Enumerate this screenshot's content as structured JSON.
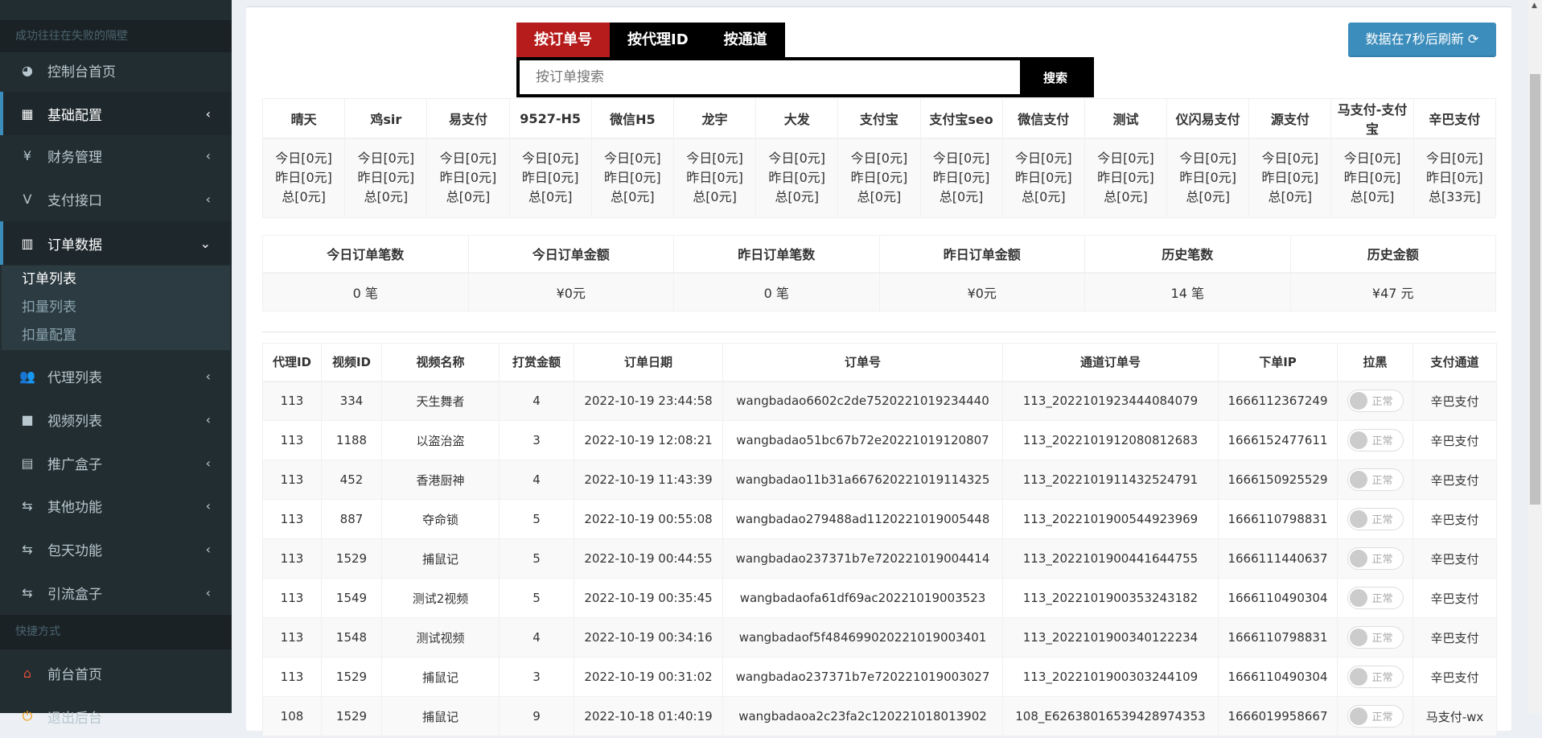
{
  "sidebar": {
    "motto": "成功往往在失败的隔壁",
    "items": [
      {
        "label": "控制台首页",
        "icon": "dashboard-icon",
        "glyph": "◕"
      },
      {
        "label": "基础配置",
        "icon": "grid-icon",
        "glyph": "▦",
        "chev": "‹"
      },
      {
        "label": "财务管理",
        "icon": "yen-icon",
        "glyph": "¥",
        "chev": "‹"
      },
      {
        "label": "支付接口",
        "icon": "vimeo-icon",
        "glyph": "V",
        "chev": "‹"
      },
      {
        "label": "订单数据",
        "icon": "bar-chart-icon",
        "glyph": "▥",
        "chev": "⌄"
      },
      {
        "label": "代理列表",
        "icon": "users-icon",
        "glyph": "👥",
        "chev": "‹"
      },
      {
        "label": "视频列表",
        "icon": "video-camera-icon",
        "glyph": "■",
        "chev": "‹"
      },
      {
        "label": "推广盒子",
        "icon": "table-icon",
        "glyph": "▤",
        "chev": "‹"
      },
      {
        "label": "其他功能",
        "icon": "retweet-icon",
        "glyph": "⇆",
        "chev": "‹"
      },
      {
        "label": "包天功能",
        "icon": "retweet-icon",
        "glyph": "⇆",
        "chev": "‹"
      },
      {
        "label": "引流盒子",
        "icon": "retweet-icon",
        "glyph": "⇆",
        "chev": "‹"
      }
    ],
    "submenu": [
      "订单列表",
      "扣量列表",
      "扣量配置"
    ],
    "shortcut_header": "快捷方式",
    "shortcuts": [
      {
        "label": "前台首页",
        "icon": "home-icon",
        "glyph": "⌂",
        "color": "#dd4b39"
      },
      {
        "label": "退出后台",
        "icon": "power-icon",
        "glyph": "⏻",
        "color": "#f39c12"
      }
    ]
  },
  "search": {
    "tabs": [
      "按订单号",
      "按代理ID",
      "按通道"
    ],
    "placeholder": "按订单搜索",
    "button": "搜索",
    "refresh": "数据在7秒后刷新 ⟳"
  },
  "channels": [
    {
      "name": "晴天",
      "today": "今日[0元]",
      "yesterday": "昨日[0元]",
      "total": "总[0元]"
    },
    {
      "name": "鸡sir",
      "today": "今日[0元]",
      "yesterday": "昨日[0元]",
      "total": "总[0元]"
    },
    {
      "name": "易支付",
      "today": "今日[0元]",
      "yesterday": "昨日[0元]",
      "total": "总[0元]"
    },
    {
      "name": "9527-H5",
      "today": "今日[0元]",
      "yesterday": "昨日[0元]",
      "total": "总[0元]"
    },
    {
      "name": "微信H5",
      "today": "今日[0元]",
      "yesterday": "昨日[0元]",
      "total": "总[0元]"
    },
    {
      "name": "龙宇",
      "today": "今日[0元]",
      "yesterday": "昨日[0元]",
      "total": "总[0元]"
    },
    {
      "name": "大发",
      "today": "今日[0元]",
      "yesterday": "昨日[0元]",
      "total": "总[0元]"
    },
    {
      "name": "支付宝",
      "today": "今日[0元]",
      "yesterday": "昨日[0元]",
      "total": "总[0元]"
    },
    {
      "name": "支付宝seo",
      "today": "今日[0元]",
      "yesterday": "昨日[0元]",
      "total": "总[0元]"
    },
    {
      "name": "微信支付",
      "today": "今日[0元]",
      "yesterday": "昨日[0元]",
      "total": "总[0元]"
    },
    {
      "name": "测试",
      "today": "今日[0元]",
      "yesterday": "昨日[0元]",
      "total": "总[0元]"
    },
    {
      "name": "仪闪易支付",
      "today": "今日[0元]",
      "yesterday": "昨日[0元]",
      "total": "总[0元]"
    },
    {
      "name": "源支付",
      "today": "今日[0元]",
      "yesterday": "昨日[0元]",
      "total": "总[0元]"
    },
    {
      "name": "马支付-支付宝",
      "today": "今日[0元]",
      "yesterday": "昨日[0元]",
      "total": "总[0元]"
    },
    {
      "name": "辛巴支付",
      "today": "今日[0元]",
      "yesterday": "昨日[0元]",
      "total": "总[33元]"
    }
  ],
  "summary": {
    "headers": [
      "今日订单笔数",
      "今日订单金额",
      "昨日订单笔数",
      "昨日订单金额",
      "历史笔数",
      "历史金额"
    ],
    "values": [
      "0 笔",
      "¥0元",
      "0 笔",
      "¥0元",
      "14 笔",
      "¥47 元"
    ]
  },
  "orders": {
    "headers": [
      "代理ID",
      "视频ID",
      "视频名称",
      "打赏金额",
      "订单日期",
      "订单号",
      "通道订单号",
      "下单IP",
      "拉黑",
      "支付通道"
    ],
    "rows": [
      [
        "113",
        "334",
        "天生舞者",
        "4",
        "2022-10-19 23:44:58",
        "wangbadao6602c2de7520221019234440",
        "113_2022101923444084079",
        "1666112367249",
        "正常",
        "辛巴支付"
      ],
      [
        "113",
        "1188",
        "以盗治盗",
        "3",
        "2022-10-19 12:08:21",
        "wangbadao51bc67b72e20221019120807",
        "113_2022101912080812683",
        "1666152477611",
        "正常",
        "辛巴支付"
      ],
      [
        "113",
        "452",
        "香港厨神",
        "4",
        "2022-10-19 11:43:39",
        "wangbadao11b31a6676202210191143​25",
        "113_2022101911432524791",
        "1666150925529",
        "正常",
        "辛巴支付"
      ],
      [
        "113",
        "887",
        "夺命锁",
        "5",
        "2022-10-19 00:55:08",
        "wangbadao279488ad1120221019005448",
        "113_2022101900544923969",
        "1666110798831",
        "正常",
        "辛巴支付"
      ],
      [
        "113",
        "1529",
        "捕鼠记",
        "5",
        "2022-10-19 00:44:55",
        "wangbadao237371b7e720221019004414",
        "113_2022101900441644755",
        "1666111440637",
        "正常",
        "辛巴支付"
      ],
      [
        "113",
        "1549",
        "测试2视频",
        "5",
        "2022-10-19 00:35:45",
        "wangbadaofa61df69ac20221019003523",
        "113_2022101900353243182",
        "1666110490304",
        "正常",
        "辛巴支付"
      ],
      [
        "113",
        "1548",
        "测试视频",
        "4",
        "2022-10-19 00:34:16",
        "wangbadaof5f484699020221019003401",
        "113_2022101900340122234",
        "1666110798831",
        "正常",
        "辛巴支付"
      ],
      [
        "113",
        "1529",
        "捕鼠记",
        "3",
        "2022-10-19 00:31:02",
        "wangbadao237371b7e720221019003027",
        "113_2022101900303244109",
        "1666110490304",
        "正常",
        "辛巴支付"
      ],
      [
        "108",
        "1529",
        "捕鼠记",
        "9",
        "2022-10-18 01:40:19",
        "wangbadaoa2c23fa2c120221018013902",
        "108_E62638016539428974353",
        "1666019958667",
        "正常",
        "马支付-wx"
      ]
    ]
  }
}
